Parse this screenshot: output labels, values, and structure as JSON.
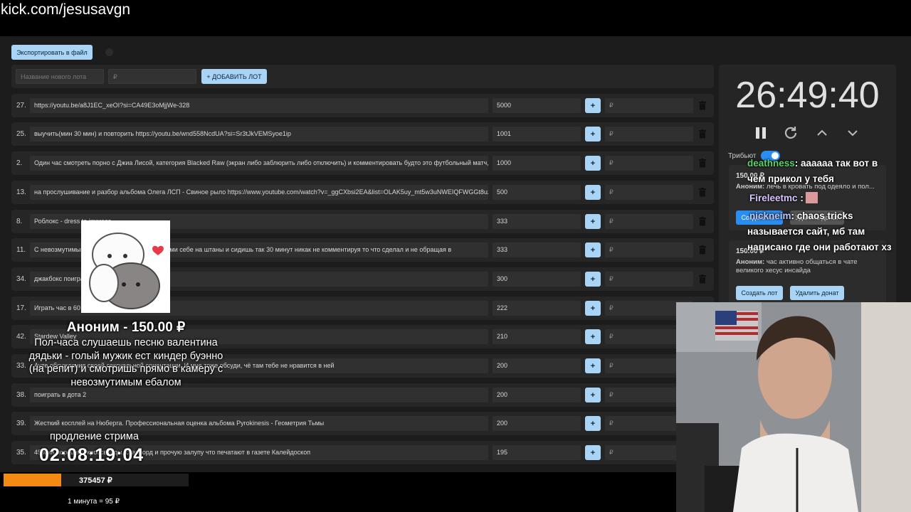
{
  "url": "kick.com/jesusavgn",
  "toolbar": {
    "export_label": "Экспортировать в файл"
  },
  "add_lot": {
    "name_placeholder": "Название нового лота",
    "price_placeholder": "₽",
    "add_label": "+ ДОБАВИТЬ ЛОТ"
  },
  "lots": [
    {
      "idx": "27.",
      "title": "https://youtu.be/a8J1EC_xeOI?si=CA49E3oMjjWe-328",
      "sum": "5000",
      "plus": "+",
      "add_placeholder": "₽"
    },
    {
      "idx": "25.",
      "title": "выучить(мин 30 мин) и повторить https://youtu.be/wnd558NcdUA?si=Sr3tJkVEMSyoe1ip",
      "sum": "1001",
      "plus": "+",
      "add_placeholder": "₽"
    },
    {
      "idx": "2.",
      "title": "Один час смотреть порно с Джиа Лисой, категория Blacked Raw (экран либо заблюрить либо отключить) и комментировать будто это футбольный матч, ф",
      "sum": "1000",
      "plus": "+",
      "add_placeholder": "₽"
    },
    {
      "idx": "13.",
      "title": "на прослушивание и разбор альбома Олега ЛСП - Свиное рыло https://www.youtube.com/watch?v=_ggCXbsi2EA&list=OLAK5uy_mt5w3uNWEIQFWGGt8uz",
      "sum": "500",
      "plus": "+",
      "add_placeholder": "₽"
    },
    {
      "idx": "8.",
      "title": "Роблокс - dress to impress",
      "sum": "333",
      "plus": "+",
      "add_placeholder": "₽"
    },
    {
      "idx": "11.",
      "title": "С невозмутимым лицом налить своего боржоми себе на штаны и сидишь так 30 минут никак не комментируя то что сделал и не обращая в",
      "sum": "333",
      "plus": "+",
      "add_placeholder": "₽"
    },
    {
      "idx": "34.",
      "title": "джакбокс поиграть",
      "sum": "300",
      "plus": "+",
      "add_placeholder": "₽"
    },
    {
      "idx": "17.",
      "title": "Играть час в 60 seconds",
      "sum": "222",
      "plus": "+",
      "add_placeholder": "₽"
    },
    {
      "idx": "42.",
      "title": "Stardew Valley",
      "sum": "210",
      "plus": "+",
      "add_placeholder": "₽"
    },
    {
      "idx": "33.",
      "title": "Ауте обсуждения своей сексуальной ориентации. И мне тоже обсуди, чё там тебе не нравится в ней",
      "sum": "200",
      "plus": "+",
      "add_placeholder": "₽"
    },
    {
      "idx": "38.",
      "title": "поиграть в дота 2",
      "sum": "200",
      "plus": "+",
      "add_placeholder": "₽"
    },
    {
      "idx": "39.",
      "title": "Жесткий косплей на Нюберга. Профессиональная оценка альбома Pyrokinesis - Геометрия Тьмы",
      "sum": "200",
      "plus": "+",
      "add_placeholder": "₽"
    },
    {
      "idx": "35.",
      "title": "45 мин порешать кроссворды, сканворд и прочую залупу что печатают в газете Калейдоскоп",
      "sum": "195",
      "plus": "+",
      "add_placeholder": "₽"
    }
  ],
  "timer": {
    "value": "26:49:40",
    "tribute_label": "Трибьют"
  },
  "donations": [
    {
      "amount": "150.00 ₽",
      "author": "Аноним:",
      "text": "лечь в кровать под одеяло и пол..."
    },
    {
      "amount": "150.00 ₽",
      "author": "Аноним:",
      "text": "час активно общаться в чате великого хесус инсайда"
    }
  ],
  "donation_buttons": {
    "create": "Создать лот",
    "delete": "Удалить донат"
  },
  "chat": [
    {
      "nick": "deathness",
      "text": ": аааааа так вот в"
    },
    {
      "nick": "",
      "text": "чём прикол у тебя"
    },
    {
      "nick": "Fireleetmc",
      "text": ":"
    },
    {
      "nick": "nickneim",
      "text": ": chaos tricks"
    },
    {
      "nick": "",
      "text": "называется сайт, мб там"
    },
    {
      "nick": "",
      "text": "написано где они работают хз"
    }
  ],
  "overlay": {
    "donor": "Аноним - 150.00 ₽",
    "message": "Пол-часа слушаешь песню валентина дядьки - голый мужик ест киндер буэнно (на репит) и смотришь прямо в камеру с невозмутимым ебалом"
  },
  "extension": {
    "label": "продление стрима",
    "timer": "02:08:19:04"
  },
  "subathon": {
    "total": "375457 ₽",
    "rate": "1 минута = 95 ₽",
    "progress": 0.31
  },
  "colors": {
    "accent": "#a9d4f5",
    "progress": "#f28a14",
    "toggle": "#2a8df0"
  }
}
